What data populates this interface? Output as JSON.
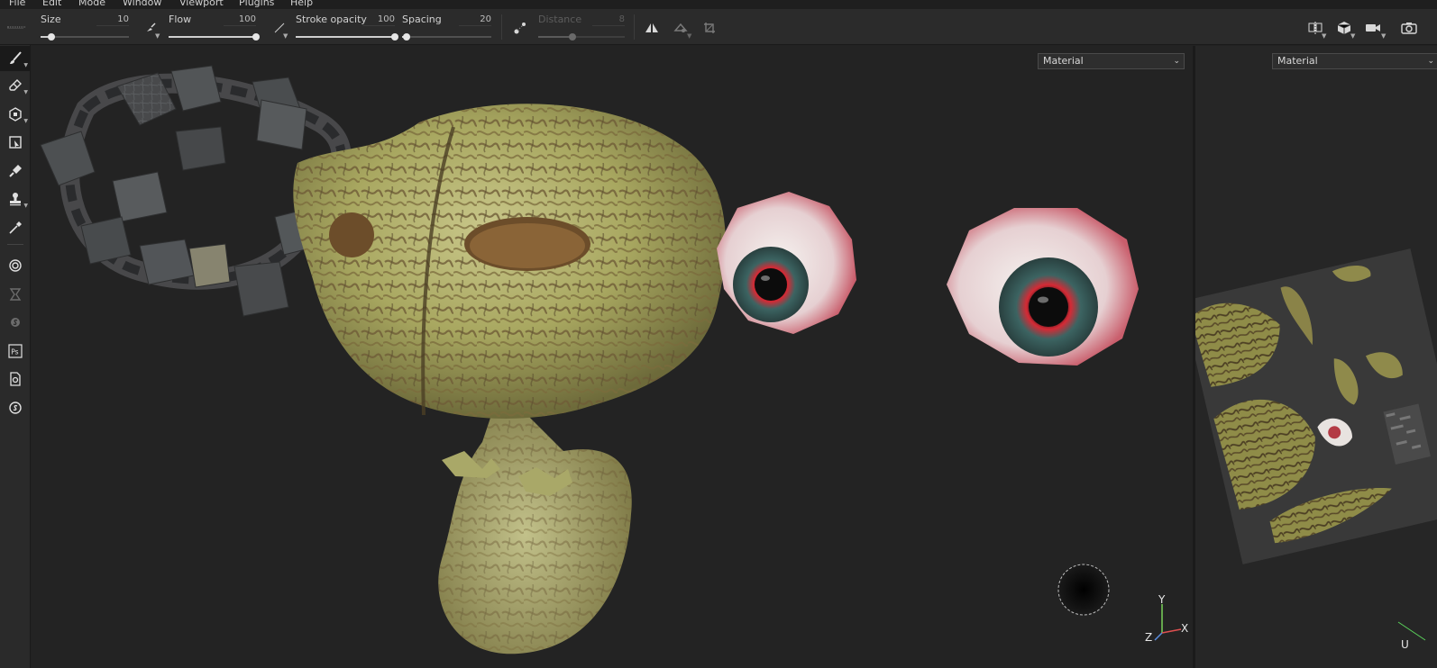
{
  "menu": [
    "File",
    "Edit",
    "Mode",
    "Window",
    "Viewport",
    "Plugins",
    "Help"
  ],
  "toolbar": {
    "size": {
      "label": "Size",
      "value": "10",
      "level": 0.12
    },
    "flow": {
      "label": "Flow",
      "value": "100",
      "level": 1.0
    },
    "stroke_opacity": {
      "label": "Stroke opacity",
      "value": "100",
      "level": 1.0
    },
    "spacing": {
      "label": "Spacing",
      "value": "20",
      "level": 0.05
    },
    "distance": {
      "label": "Distance",
      "value": "8",
      "level": 0.4
    }
  },
  "viewport_3d": {
    "display_mode": "Material"
  },
  "viewport_2d": {
    "display_mode": "Material"
  },
  "axis_gizmo": {
    "y": "Y",
    "x": "X",
    "z": "Z"
  },
  "uv_gizmo": {
    "u": "U"
  },
  "colors": {
    "accent": "#cfcfcf",
    "background": "#232323"
  }
}
